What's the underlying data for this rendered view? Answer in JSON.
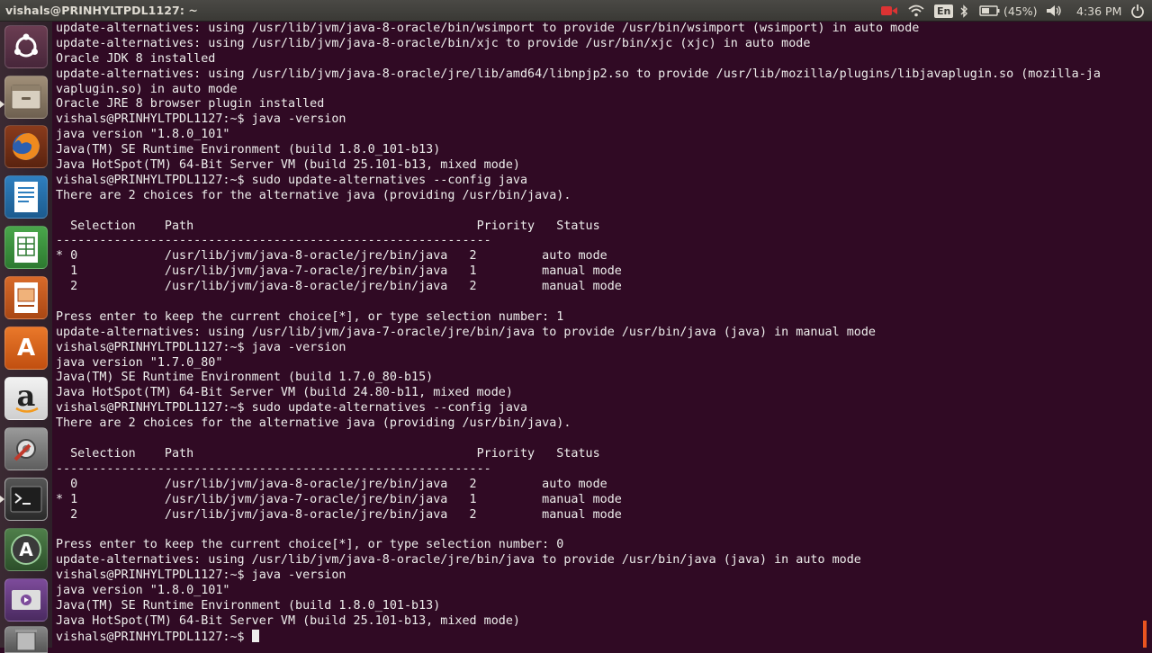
{
  "window": {
    "title": "vishals@PRINHYLTPDL1127: ~"
  },
  "topbar": {
    "keyboard_layout": "En",
    "battery_percent": "(45%)",
    "clock": "4:36 PM"
  },
  "launcher": {
    "items": [
      {
        "name": "dash-home-icon",
        "label": "Search your computer"
      },
      {
        "name": "files-icon",
        "label": "Files"
      },
      {
        "name": "firefox-icon",
        "label": "Firefox Web Browser"
      },
      {
        "name": "libreoffice-writer-icon",
        "label": "LibreOffice Writer"
      },
      {
        "name": "libreoffice-calc-icon",
        "label": "LibreOffice Calc"
      },
      {
        "name": "libreoffice-impress-icon",
        "label": "LibreOffice Impress"
      },
      {
        "name": "software-center-icon",
        "label": "Ubuntu Software Center"
      },
      {
        "name": "amazon-icon",
        "label": "Amazon"
      },
      {
        "name": "system-settings-icon",
        "label": "System Settings"
      },
      {
        "name": "terminal-icon",
        "label": "Terminal"
      },
      {
        "name": "software-updater-icon",
        "label": "Software Updater"
      },
      {
        "name": "video-player-icon",
        "label": "Videos"
      },
      {
        "name": "trash-icon",
        "label": "Trash"
      }
    ],
    "glyphs": {
      "software_center": "A",
      "amazon": "a",
      "updater": "A"
    }
  },
  "terminal": {
    "lines": [
      "update-alternatives: using /usr/lib/jvm/java-8-oracle/bin/wsimport to provide /usr/bin/wsimport (wsimport) in auto mode",
      "update-alternatives: using /usr/lib/jvm/java-8-oracle/bin/xjc to provide /usr/bin/xjc (xjc) in auto mode",
      "Oracle JDK 8 installed",
      "update-alternatives: using /usr/lib/jvm/java-8-oracle/jre/lib/amd64/libnpjp2.so to provide /usr/lib/mozilla/plugins/libjavaplugin.so (mozilla-ja",
      "vaplugin.so) in auto mode",
      "Oracle JRE 8 browser plugin installed",
      "vishals@PRINHYLTPDL1127:~$ java -version",
      "java version \"1.8.0_101\"",
      "Java(TM) SE Runtime Environment (build 1.8.0_101-b13)",
      "Java HotSpot(TM) 64-Bit Server VM (build 25.101-b13, mixed mode)",
      "vishals@PRINHYLTPDL1127:~$ sudo update-alternatives --config java",
      "There are 2 choices for the alternative java (providing /usr/bin/java).",
      "",
      "  Selection    Path                                       Priority   Status",
      "------------------------------------------------------------",
      "* 0            /usr/lib/jvm/java-8-oracle/jre/bin/java   2         auto mode",
      "  1            /usr/lib/jvm/java-7-oracle/jre/bin/java   1         manual mode",
      "  2            /usr/lib/jvm/java-8-oracle/jre/bin/java   2         manual mode",
      "",
      "Press enter to keep the current choice[*], or type selection number: 1",
      "update-alternatives: using /usr/lib/jvm/java-7-oracle/jre/bin/java to provide /usr/bin/java (java) in manual mode",
      "vishals@PRINHYLTPDL1127:~$ java -version",
      "java version \"1.7.0_80\"",
      "Java(TM) SE Runtime Environment (build 1.7.0_80-b15)",
      "Java HotSpot(TM) 64-Bit Server VM (build 24.80-b11, mixed mode)",
      "vishals@PRINHYLTPDL1127:~$ sudo update-alternatives --config java",
      "There are 2 choices for the alternative java (providing /usr/bin/java).",
      "",
      "  Selection    Path                                       Priority   Status",
      "------------------------------------------------------------",
      "  0            /usr/lib/jvm/java-8-oracle/jre/bin/java   2         auto mode",
      "* 1            /usr/lib/jvm/java-7-oracle/jre/bin/java   1         manual mode",
      "  2            /usr/lib/jvm/java-8-oracle/jre/bin/java   2         manual mode",
      "",
      "Press enter to keep the current choice[*], or type selection number: 0",
      "update-alternatives: using /usr/lib/jvm/java-8-oracle/jre/bin/java to provide /usr/bin/java (java) in auto mode",
      "vishals@PRINHYLTPDL1127:~$ java -version",
      "java version \"1.8.0_101\"",
      "Java(TM) SE Runtime Environment (build 1.8.0_101-b13)",
      "Java HotSpot(TM) 64-Bit Server VM (build 25.101-b13, mixed mode)"
    ],
    "prompt": "vishals@PRINHYLTPDL1127:~$ "
  },
  "colors": {
    "terminal_bg": "#300a24",
    "terminal_fg": "#eeeeec",
    "accent": "#e95420"
  }
}
